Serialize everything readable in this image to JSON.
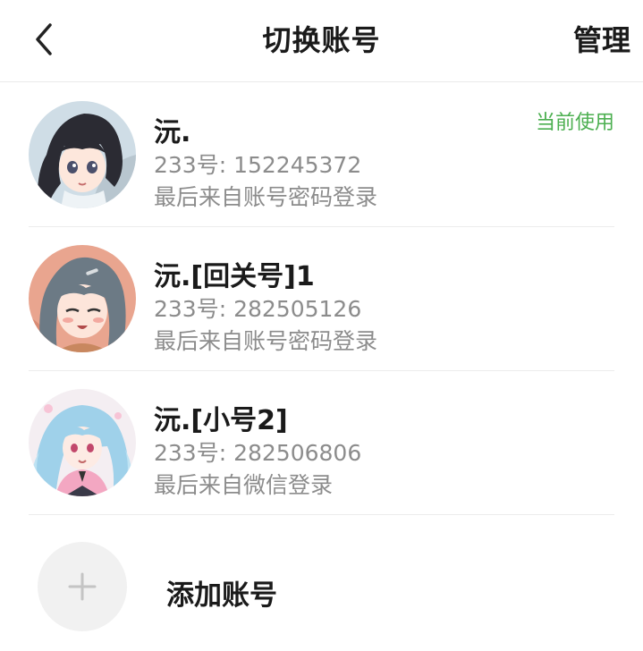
{
  "header": {
    "title": "切换账号",
    "manage_label": "管理"
  },
  "accounts": [
    {
      "name": "沅.",
      "id_text": "233号: 152245372",
      "login_text": "最后来自账号密码登录",
      "badge": "当前使用",
      "avatar_icon": "anime-avatar-dark-hair"
    },
    {
      "name": "沅.[回关号]1",
      "id_text": "233号: 282505126",
      "login_text": "最后来自账号密码登录",
      "avatar_icon": "anime-avatar-grey-hair"
    },
    {
      "name": "沅.[小号2]",
      "id_text": "233号: 282506806",
      "login_text": "最后来自微信登录",
      "avatar_icon": "anime-avatar-blue-hair"
    }
  ],
  "add_account": {
    "label": "添加账号"
  },
  "colors": {
    "accent_green": "#4caf50",
    "secondary_text": "#8c8c8c",
    "divider": "#ececec"
  }
}
